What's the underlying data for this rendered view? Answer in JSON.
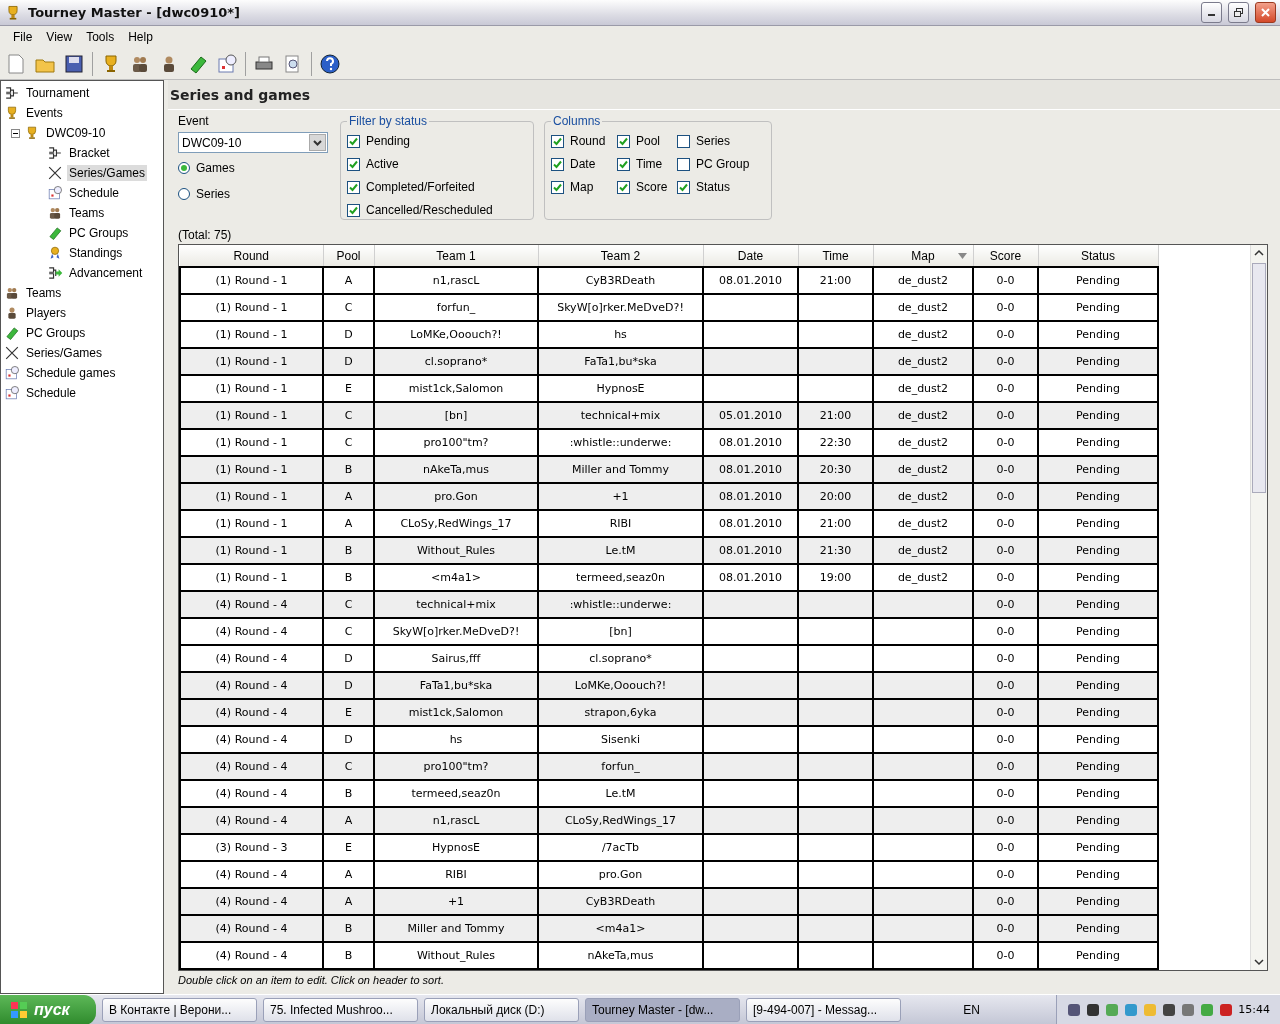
{
  "window": {
    "title": "Tourney Master - [dwc0910*]"
  },
  "menu": [
    "File",
    "View",
    "Tools",
    "Help"
  ],
  "sidebar": {
    "items": [
      {
        "label": "Tournament",
        "selected": false
      },
      {
        "label": "Events",
        "selected": false
      },
      {
        "label": "DWC09-10",
        "selected": false,
        "expanded": true,
        "children": [
          {
            "label": "Bracket",
            "selected": false
          },
          {
            "label": "Series/Games",
            "selected": true
          },
          {
            "label": "Schedule",
            "selected": false
          },
          {
            "label": "Teams",
            "selected": false
          },
          {
            "label": "PC Groups",
            "selected": false
          },
          {
            "label": "Standings",
            "selected": false
          },
          {
            "label": "Advancement",
            "selected": false
          }
        ]
      },
      {
        "label": "Teams",
        "selected": false
      },
      {
        "label": "Players",
        "selected": false
      },
      {
        "label": "PC Groups",
        "selected": false
      },
      {
        "label": "Series/Games",
        "selected": false
      },
      {
        "label": "Schedule games",
        "selected": false
      },
      {
        "label": "Schedule",
        "selected": false
      }
    ]
  },
  "page": {
    "title": "Series and games",
    "event": {
      "label": "Event",
      "value": "DWC09-10"
    },
    "view": [
      {
        "label": "Games",
        "selected": true
      },
      {
        "label": "Series",
        "selected": false
      }
    ],
    "filter": {
      "title": "Filter by status",
      "items": [
        {
          "label": "Pending",
          "checked": true
        },
        {
          "label": "Active",
          "checked": true
        },
        {
          "label": "Completed/Forfeited",
          "checked": true
        },
        {
          "label": "Cancelled/Rescheduled",
          "checked": true
        }
      ]
    },
    "columns_box": {
      "title": "Columns",
      "items": [
        {
          "label": "Round",
          "checked": true
        },
        {
          "label": "Pool",
          "checked": true
        },
        {
          "label": "Series",
          "checked": false
        },
        {
          "label": "Date",
          "checked": true
        },
        {
          "label": "Time",
          "checked": true
        },
        {
          "label": "PC Group",
          "checked": false
        },
        {
          "label": "Map",
          "checked": true
        },
        {
          "label": "Score",
          "checked": true
        },
        {
          "label": "Status",
          "checked": true
        }
      ]
    },
    "total": "(Total: 75)",
    "table": {
      "columns": [
        {
          "label": "Round",
          "sorted": false
        },
        {
          "label": "Pool",
          "sorted": false
        },
        {
          "label": "Team 1",
          "sorted": false
        },
        {
          "label": "Team 2",
          "sorted": false
        },
        {
          "label": "Date",
          "sorted": false
        },
        {
          "label": "Time",
          "sorted": false
        },
        {
          "label": "Map",
          "sorted": true
        },
        {
          "label": "Score",
          "sorted": false
        },
        {
          "label": "Status",
          "sorted": false
        }
      ],
      "rows": [
        {
          "shaded": false,
          "cells": [
            "(1) Round - 1",
            "A",
            "n1,rascL",
            "CyB3RDeath",
            "08.01.2010",
            "21:00",
            "de_dust2",
            "0-0",
            "Pending"
          ]
        },
        {
          "shaded": false,
          "cells": [
            "(1) Round - 1",
            "C",
            "forfun_",
            "SkyW[o]rker.MeDveD?!",
            "",
            "",
            "de_dust2",
            "0-0",
            "Pending"
          ]
        },
        {
          "shaded": false,
          "cells": [
            "(1) Round - 1",
            "D",
            "LoMKe,Ooouch?!",
            "hs",
            "",
            "",
            "de_dust2",
            "0-0",
            "Pending"
          ]
        },
        {
          "shaded": true,
          "cells": [
            "(1) Round - 1",
            "D",
            "cl.soprano*",
            "FaTa1,bu*ska",
            "",
            "",
            "de_dust2",
            "0-0",
            "Pending"
          ]
        },
        {
          "shaded": false,
          "cells": [
            "(1) Round - 1",
            "E",
            "mist1ck,Salomon",
            "HypnosE",
            "",
            "",
            "de_dust2",
            "0-0",
            "Pending"
          ]
        },
        {
          "shaded": true,
          "cells": [
            "(1) Round - 1",
            "C",
            "[bn]",
            "technical+mix",
            "05.01.2010",
            "21:00",
            "de_dust2",
            "0-0",
            "Pending"
          ]
        },
        {
          "shaded": false,
          "cells": [
            "(1) Round - 1",
            "C",
            "pro100\"tm?",
            ":whistle::underwe:",
            "08.01.2010",
            "22:30",
            "de_dust2",
            "0-0",
            "Pending"
          ]
        },
        {
          "shaded": true,
          "cells": [
            "(1) Round - 1",
            "B",
            "nAkeTa,mus",
            "Miller and Tommy",
            "08.01.2010",
            "20:30",
            "de_dust2",
            "0-0",
            "Pending"
          ]
        },
        {
          "shaded": true,
          "cells": [
            "(1) Round - 1",
            "A",
            "pro.Gon",
            "+1",
            "08.01.2010",
            "20:00",
            "de_dust2",
            "0-0",
            "Pending"
          ]
        },
        {
          "shaded": false,
          "cells": [
            "(1) Round - 1",
            "A",
            "CLoSy,RedWings_17",
            "RIBI",
            "08.01.2010",
            "21:00",
            "de_dust2",
            "0-0",
            "Pending"
          ]
        },
        {
          "shaded": true,
          "cells": [
            "(1) Round - 1",
            "B",
            "Without_Rules",
            "Le.tM",
            "08.01.2010",
            "21:30",
            "de_dust2",
            "0-0",
            "Pending"
          ]
        },
        {
          "shaded": false,
          "cells": [
            "(1) Round - 1",
            "B",
            "<m4a1>",
            "termeed,seaz0n",
            "08.01.2010",
            "19:00",
            "de_dust2",
            "0-0",
            "Pending"
          ]
        },
        {
          "shaded": true,
          "cells": [
            "(4) Round - 4",
            "C",
            "technical+mix",
            ":whistle::underwe:",
            "",
            "",
            "",
            "0-0",
            "Pending"
          ]
        },
        {
          "shaded": false,
          "cells": [
            "(4) Round - 4",
            "C",
            "SkyW[o]rker.MeDveD?!",
            "[bn]",
            "",
            "",
            "",
            "0-0",
            "Pending"
          ]
        },
        {
          "shaded": false,
          "cells": [
            "(4) Round - 4",
            "D",
            "Sairus,fff",
            "cl.soprano*",
            "",
            "",
            "",
            "0-0",
            "Pending"
          ]
        },
        {
          "shaded": true,
          "cells": [
            "(4) Round - 4",
            "D",
            "FaTa1,bu*ska",
            "LoMKe,Ooouch?!",
            "",
            "",
            "",
            "0-0",
            "Pending"
          ]
        },
        {
          "shaded": true,
          "cells": [
            "(4) Round - 4",
            "E",
            "mist1ck,Salomon",
            "strapon,6yka",
            "",
            "",
            "",
            "0-0",
            "Pending"
          ]
        },
        {
          "shaded": false,
          "cells": [
            "(4) Round - 4",
            "D",
            "hs",
            "Sisenki",
            "",
            "",
            "",
            "0-0",
            "Pending"
          ]
        },
        {
          "shaded": true,
          "cells": [
            "(4) Round - 4",
            "C",
            "pro100\"tm?",
            "forfun_",
            "",
            "",
            "",
            "0-0",
            "Pending"
          ]
        },
        {
          "shaded": false,
          "cells": [
            "(4) Round - 4",
            "B",
            "termeed,seaz0n",
            "Le.tM",
            "",
            "",
            "",
            "0-0",
            "Pending"
          ]
        },
        {
          "shaded": true,
          "cells": [
            "(4) Round - 4",
            "A",
            "n1,rascL",
            "CLoSy,RedWings_17",
            "",
            "",
            "",
            "0-0",
            "Pending"
          ]
        },
        {
          "shaded": false,
          "cells": [
            "(3) Round - 3",
            "E",
            "HypnosE",
            "/7acTb",
            "",
            "",
            "",
            "0-0",
            "Pending"
          ]
        },
        {
          "shaded": false,
          "cells": [
            "(4) Round - 4",
            "A",
            "RIBI",
            "pro.Gon",
            "",
            "",
            "",
            "0-0",
            "Pending"
          ]
        },
        {
          "shaded": true,
          "cells": [
            "(4) Round - 4",
            "A",
            "+1",
            "CyB3RDeath",
            "",
            "",
            "",
            "0-0",
            "Pending"
          ]
        },
        {
          "shaded": true,
          "cells": [
            "(4) Round - 4",
            "B",
            "Miller and Tommy",
            "<m4a1>",
            "",
            "",
            "",
            "0-0",
            "Pending"
          ]
        },
        {
          "shaded": false,
          "cells": [
            "(4) Round - 4",
            "B",
            "Without_Rules",
            "nAkeTa,mus",
            "",
            "",
            "",
            "0-0",
            "Pending"
          ]
        }
      ]
    },
    "hint": "Double click on an item to edit. Click on header to sort."
  },
  "taskbar": {
    "start": "пуск",
    "tasks": [
      {
        "label": "В Контакте | Верони...",
        "selected": false
      },
      {
        "label": "75. Infected Mushroo...",
        "selected": false
      },
      {
        "label": "Локальный диск (D:)",
        "selected": false
      },
      {
        "label": "Tourney Master - [dw...",
        "selected": true
      },
      {
        "label": "[9-494-007] - Messag...",
        "selected": false
      }
    ],
    "language": "EN",
    "clock": "15:44"
  }
}
